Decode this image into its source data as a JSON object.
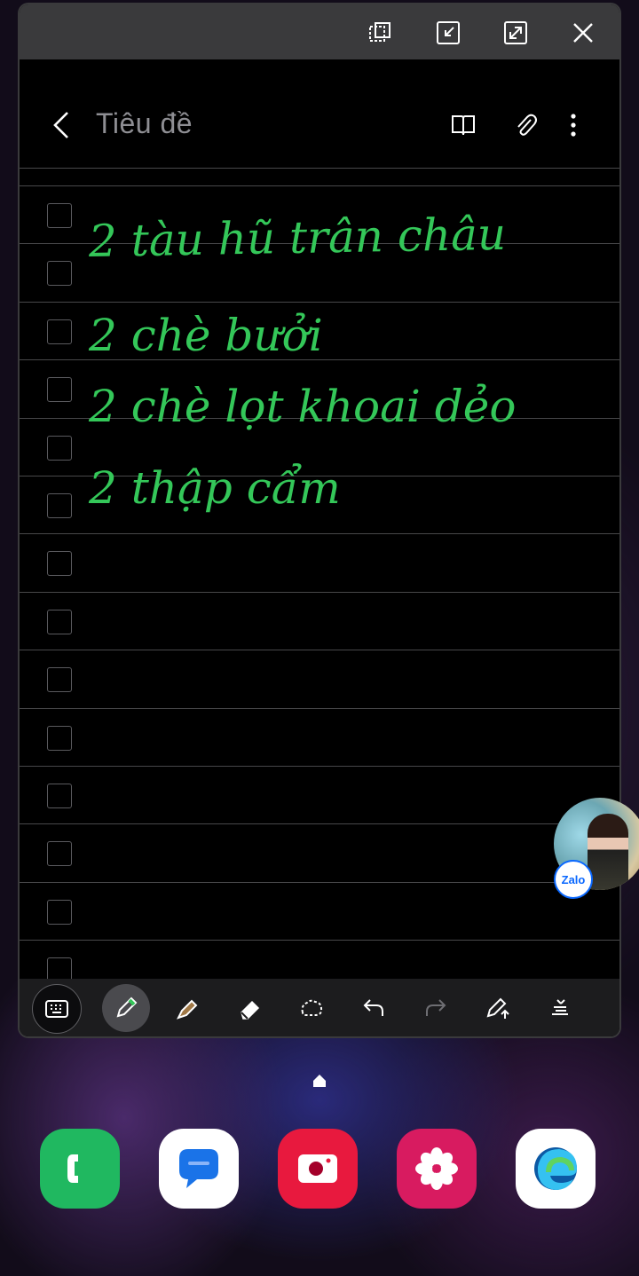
{
  "note": {
    "title": "Tiêu đề",
    "handwriting": [
      "2 tàu hũ trân châu",
      "2 chè bưởi",
      "2 chè lọt khoai dẻo",
      "2 thập cẩm"
    ],
    "checklist_rows": 14,
    "ink_color": "#34c759"
  },
  "window_controls": {
    "icons": [
      "pop-out-icon",
      "minimize-icon",
      "maximize-icon",
      "close-icon"
    ]
  },
  "header_actions": {
    "icons": [
      "back-icon",
      "book-icon",
      "attach-icon",
      "more-icon"
    ]
  },
  "toolbar": {
    "tools": [
      "keyboard-icon",
      "pen-icon",
      "highlighter-icon",
      "eraser-icon",
      "lasso-icon",
      "undo-icon",
      "redo-icon",
      "pen-settings-icon",
      "text-align-icon"
    ],
    "active_tool": "pen-icon"
  },
  "chat_bubble": {
    "badge_label": "Zalo"
  },
  "dock": {
    "apps": [
      "Phone",
      "Messages",
      "Camera",
      "Gallery",
      "Edge"
    ],
    "colors": {
      "phone": "#20b860",
      "messages": "#ffffff",
      "camera": "#e8193e",
      "gallery": "#d81b60",
      "edge": "#ffffff"
    }
  }
}
